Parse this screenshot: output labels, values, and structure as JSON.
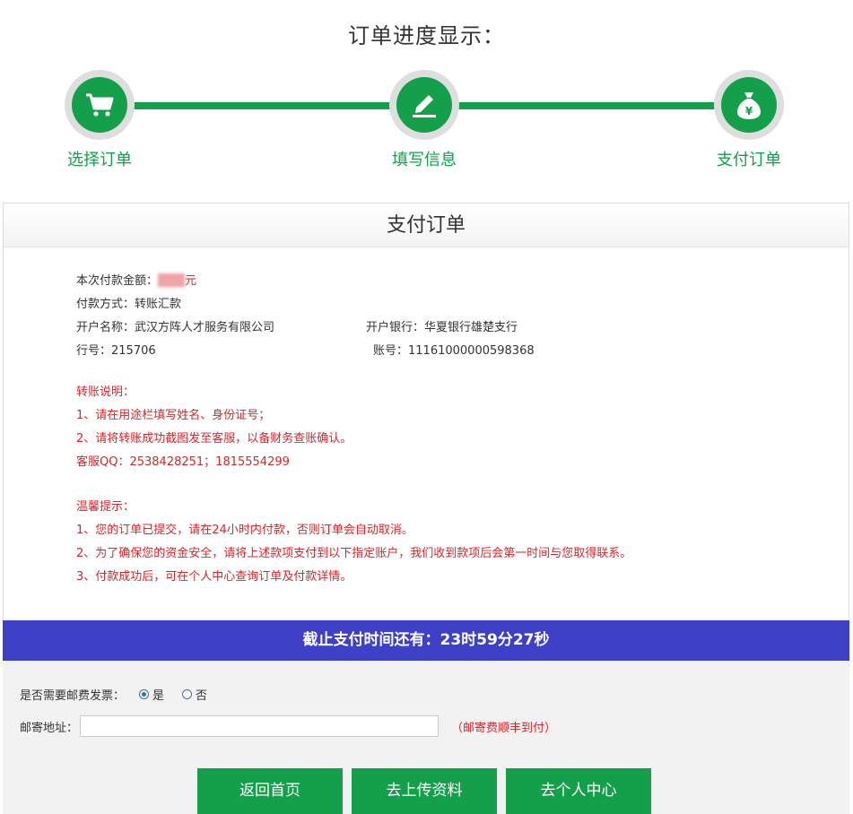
{
  "page_title": "订单进度显示：",
  "steps": [
    {
      "label": "选择订单",
      "icon": "cart-icon"
    },
    {
      "label": "填写信息",
      "icon": "edit-icon"
    },
    {
      "label": "支付订单",
      "icon": "money-bag-icon"
    }
  ],
  "panel": {
    "title": "支付订单",
    "amount_label": "本次付款金额：",
    "amount_value": "███",
    "amount_unit": "元",
    "payment_method": "付款方式：转账汇款",
    "account_name": "开户名称：武汉方阵人才服务有限公司",
    "bank": "开户银行：华夏银行雄楚支行",
    "bank_code": "行号：215706",
    "account_no": "账号：11161000000598368",
    "transfer_title": "转账说明：",
    "transfer_notes": [
      "1、请在用途栏填写姓名、身份证号；",
      "2、请将转账成功截图发至客服，以备财务查账确认。",
      "客服QQ：2538428251；1815554299"
    ],
    "tips_title": "温馨提示：",
    "tips": [
      "1、您的订单已提交，请在24小时内付款，否则订单会自动取消。",
      "2、为了确保您的资金安全，请将上述款项支付到以下指定账户，我们收到款项后会第一时间与您取得联系。",
      "3、付款成功后，可在个人中心查询订单及付款详情。"
    ]
  },
  "countdown": "截止支付时间还有：23时59分27秒",
  "form": {
    "invoice_label": "是否需要邮费发票：",
    "option_yes": "是",
    "option_no": "否",
    "selected": "是",
    "address_label": "邮寄地址：",
    "address_value": "",
    "address_note": "（邮寄费顺丰到付）"
  },
  "buttons": {
    "home": "返回首页",
    "upload": "去上传资料",
    "user_center": "去个人中心"
  },
  "colors": {
    "green": "#14a04a",
    "countdown_bg": "#3f40c8",
    "notice_red": "#d8262b"
  }
}
